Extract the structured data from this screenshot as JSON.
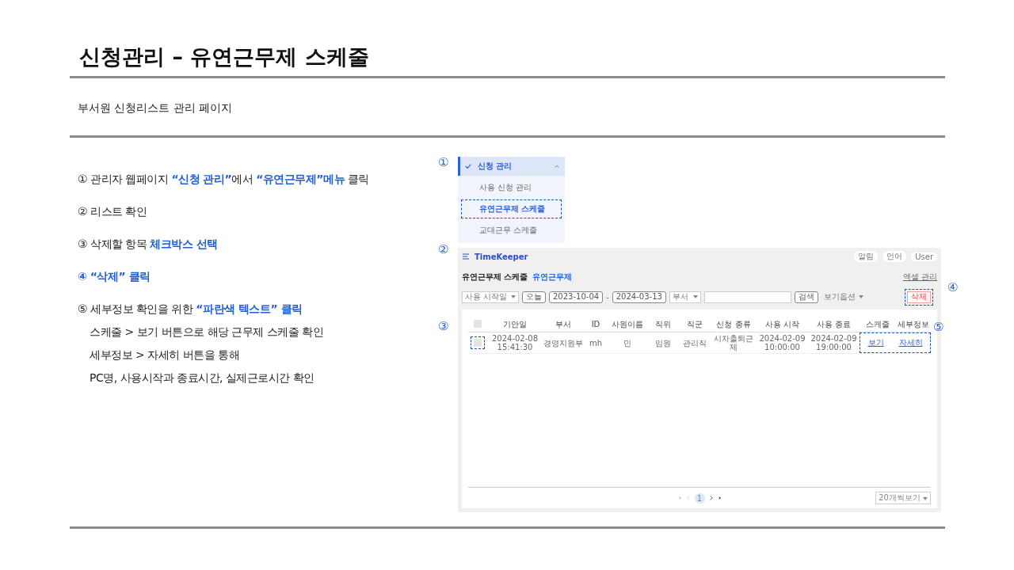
{
  "title": "신청관리 – 유연근무제 스케줄",
  "subtitle": "부서원 신청리스트 관리 페이지",
  "steps": [
    {
      "number": "①",
      "text": "관리자 웹페이지 **“신청 관리”**에서 **“유연근무제”메뉴** 클릭",
      "highlight": false
    },
    {
      "number": "②",
      "text": "리스트 확인",
      "highlight": false
    },
    {
      "number": "③",
      "text": "삭제할 항목 **체크박스 선택**",
      "highlight": false
    },
    {
      "number": "④",
      "text": "“삭제” 클릭",
      "highlight": true
    },
    {
      "number": "⑤",
      "text": "세부정보 확인을 위한 **“파란색 텍스트” 클릭**",
      "highlight": false,
      "details": [
        "스케줄 > 보기 버튼으로 해당 근무제 스케줄 확인",
        "세부정보 >  자세히 버튼을 통해",
        "PC명, 사용시작과 종료시간, 실제근로시간 확인"
      ]
    }
  ],
  "callouts": [
    "①",
    "②",
    "③",
    "④",
    "⑤"
  ],
  "menu": {
    "header": "신청 관리",
    "expanded": true,
    "items": [
      {
        "label": "사용 신청 관리",
        "selected": false
      },
      {
        "label": "유연근무제 스케줄",
        "selected": true
      },
      {
        "label": "교대근무 스케줄",
        "selected": false
      }
    ]
  },
  "app": {
    "brand": "TimeKeeper",
    "header_buttons": [
      "알림",
      "언어"
    ],
    "user": "User",
    "page_title": "유연근무제 스케줄",
    "breadcrumb": "유연근무제",
    "top_link": "엑셀 관리",
    "filters": {
      "date_type": "사용 시작일",
      "today": "오늘",
      "start": "2023-10-04",
      "separator": "-",
      "end": "2024-03-13",
      "department": "부서",
      "search": "검색",
      "view_options": "보기옵션",
      "delete": "삭제",
      "delete_highlighted": true
    },
    "select_all": false,
    "columns": [
      "기안일",
      "부서",
      "ID",
      "사원이름",
      "직위",
      "직군",
      "신청 종류",
      "사용 시작",
      "사용 종료",
      "스케줄",
      "세부정보"
    ],
    "rows": [
      {
        "cells": [
          "2024-02-08 15:41:30",
          "경영지원부",
          "mh",
          "민",
          "임원",
          "관리직",
          "시차출퇴근제",
          "2024-02-09 10:00:00",
          "2024-02-09 19:00:00"
        ],
        "links": [
          "보기",
          "자세히"
        ],
        "checked": false,
        "checkbox_highlighted": true,
        "links_highlighted": true
      }
    ],
    "pagination": {
      "pages": [
        {
          "label": "1",
          "selected": true
        }
      ],
      "page_size": "20개씩보기"
    }
  }
}
